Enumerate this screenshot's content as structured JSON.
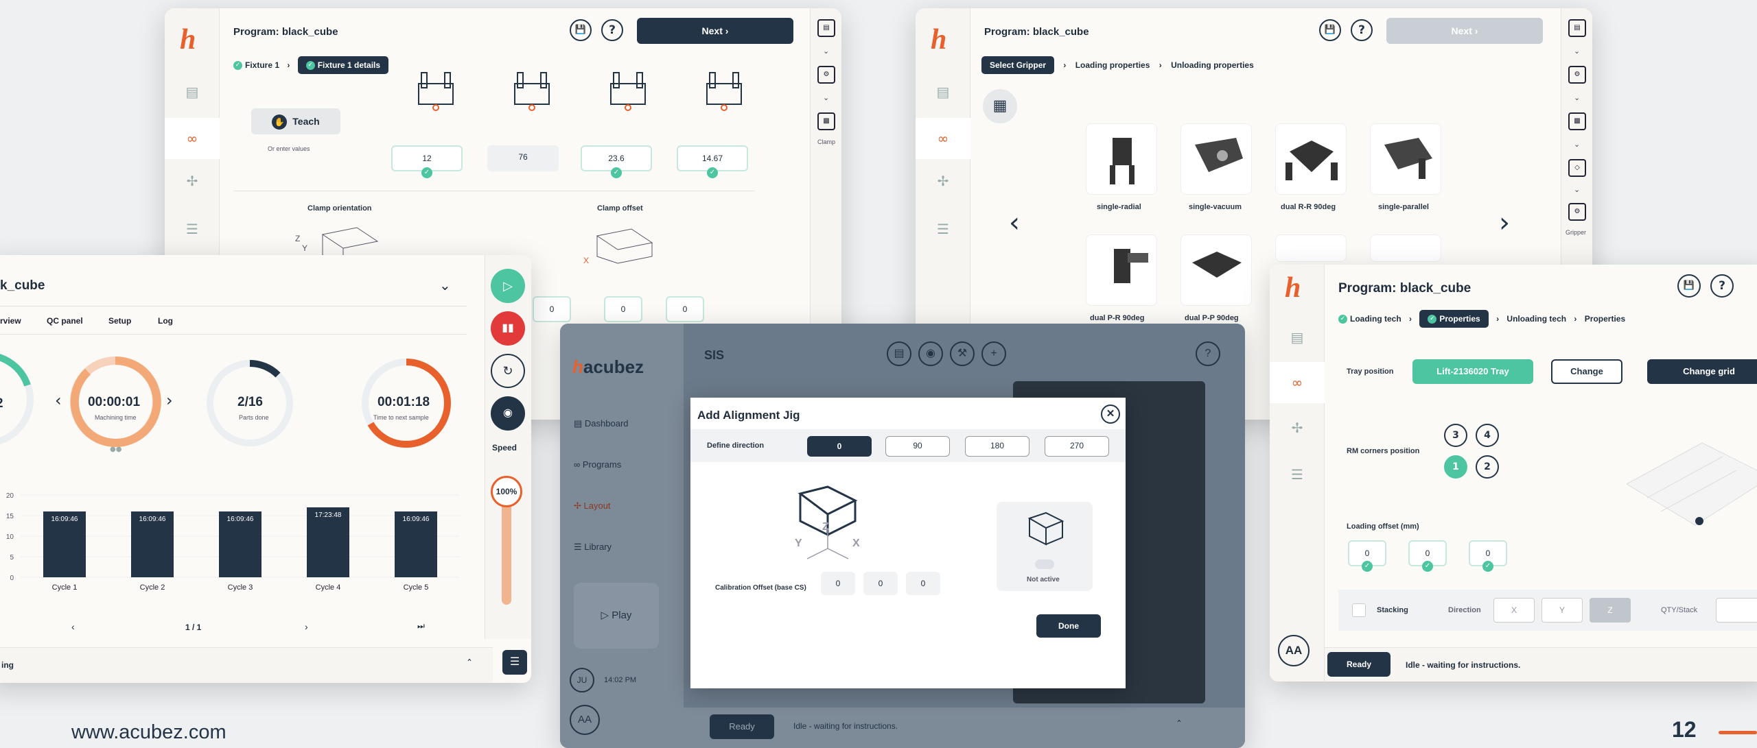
{
  "footer": {
    "url": "www.acubez.com",
    "page": "12"
  },
  "w1": {
    "title": "Program: black_cube",
    "next": "Next",
    "crumbs": [
      "Fixture 1",
      "Fixture 1 details"
    ],
    "teach": "Teach",
    "or_enter": "Or enter values",
    "values": [
      "12",
      "76",
      "23.6",
      "14.67"
    ],
    "clamp_orientation": "Clamp orientation",
    "clamp_offset": "Clamp offset",
    "offsets": [
      "0",
      "0",
      "0"
    ],
    "rail_clamp": "Clamp"
  },
  "w2": {
    "title": "Program: black_cube",
    "next": "Next",
    "crumbs": [
      "Select Gripper",
      "Loading properties",
      "Unloading properties"
    ],
    "grippers": [
      "single-radial",
      "single-vacuum",
      "dual R-R 90deg",
      "single-parallel",
      "dual P-R 90deg",
      "dual P-P 90deg"
    ],
    "rail_gripper": "Gripper"
  },
  "w3": {
    "title": "k_cube",
    "tabs": [
      "rview",
      "QC panel",
      "Setup",
      "Log"
    ],
    "gauges": [
      {
        "value": "2",
        "label": ""
      },
      {
        "value": "00:00:01",
        "label": "Machining time",
        "progress": 0.85
      },
      {
        "value": "2/16",
        "label": "Parts done",
        "progress": 0.125
      },
      {
        "value": "00:01:18",
        "label": "Time to next sample",
        "progress": 0.7
      }
    ],
    "speed_label": "Speed",
    "speed_value": "100%",
    "speed_level": 1.0,
    "pager": "1 / 1",
    "status": "ing",
    "chart_data": {
      "type": "bar",
      "categories": [
        "Cycle 1",
        "Cycle 2",
        "Cycle 3",
        "Cycle 4",
        "Cycle 5"
      ],
      "values": [
        16,
        16,
        16,
        17,
        16
      ],
      "data_labels": [
        "16:09:46",
        "16:09:46",
        "16:09:46",
        "17:23:48",
        "16:09:46"
      ],
      "ylim": [
        0,
        20
      ],
      "yticks": [
        "0",
        "5",
        "10",
        "15",
        "20"
      ],
      "color": "#233446"
    }
  },
  "w4": {
    "brand": "acubez",
    "sis": "SIS",
    "menu": [
      "Dashboard",
      "Programs",
      "Layout",
      "Library"
    ],
    "play": "Play",
    "user": "JU",
    "time": "14:02 PM",
    "avatar": "AA",
    "status_chip": "Ready",
    "status_text": "Idle - waiting for instructions."
  },
  "dialog": {
    "title": "Add Alignment Jig",
    "define_direction": "Define direction",
    "directions": [
      "0",
      "90",
      "180",
      "270"
    ],
    "calibration_label": "Calibration Offset (base CS)",
    "offsets": [
      "0",
      "0",
      "0"
    ],
    "axes": [
      "X",
      "Y",
      "Z"
    ],
    "not_active": "Not active",
    "done": "Done"
  },
  "w5": {
    "title": "Program: black_cube",
    "crumbs": [
      "Loading tech",
      "Properties",
      "Unloading tech",
      "Properties"
    ],
    "tray_position": "Tray position",
    "tray_value": "Lift-2136020 Tray",
    "change": "Change",
    "change_grid": "Change grid",
    "rm_corners": "RM corners position",
    "corners": [
      "3",
      "4",
      "1",
      "2"
    ],
    "loading_offset": "Loading offset (mm)",
    "offsets": [
      "0",
      "0",
      "0"
    ],
    "stacking": "Stacking",
    "direction": "Direction",
    "dir_opts": [
      "X",
      "Y",
      "Z"
    ],
    "qty_stack": "QTY/Stack",
    "avatar": "AA",
    "status_chip": "Ready",
    "status_text": "Idle - waiting for instructions."
  },
  "colors": {
    "accent": "#e8612c",
    "navy": "#233446",
    "teal": "#4cc5a0"
  }
}
